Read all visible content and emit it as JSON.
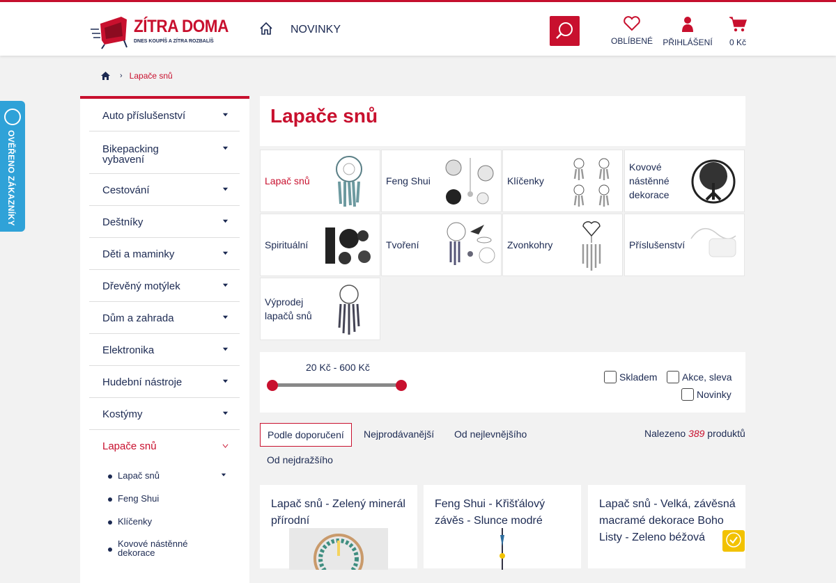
{
  "header": {
    "logo_title": "ZÍTRA DOMA",
    "logo_subtitle": "DNES KOUPÍŠ A ZÍTRA ROZBALÍŠ",
    "nav_novinky": "NOVINKY",
    "favorites_label": "OBLÍBENÉ",
    "login_label": "PŘIHLÁŠENÍ",
    "cart_total": "0 Kč"
  },
  "badge": {
    "text": "OVĚŘENO ZÁKAZNÍKY"
  },
  "breadcrumb": {
    "current": "Lapače snů"
  },
  "sidebar": {
    "categories": [
      {
        "label": "Auto příslušenství"
      },
      {
        "label": "Bikepacking vybavení"
      },
      {
        "label": "Cestování"
      },
      {
        "label": "Deštníky"
      },
      {
        "label": "Děti a maminky"
      },
      {
        "label": "Dřevěný motýlek"
      },
      {
        "label": "Dům a zahrada"
      },
      {
        "label": "Elektronika"
      },
      {
        "label": "Hudební nástroje"
      },
      {
        "label": "Kostýmy"
      },
      {
        "label": "Lapače snů"
      }
    ],
    "subcategories": [
      {
        "label": "Lapač snů"
      },
      {
        "label": "Feng Shui"
      },
      {
        "label": "Klíčenky"
      },
      {
        "label": "Kovové nástěnné dekorace"
      }
    ]
  },
  "main": {
    "title": "Lapače snů",
    "tiles": [
      {
        "label": "Lapač snů"
      },
      {
        "label": "Feng Shui"
      },
      {
        "label": "Klíčenky"
      },
      {
        "label": "Kovové nástěnné dekorace"
      },
      {
        "label": "Spirituální"
      },
      {
        "label": "Tvoření"
      },
      {
        "label": "Zvonkohry"
      },
      {
        "label": "Příslušenství"
      },
      {
        "label": "Výprodej lapačů snů"
      }
    ]
  },
  "filter": {
    "price_range": "20 Kč - 600 Kč",
    "price_min": 20,
    "price_max": 600,
    "skladem": "Skladem",
    "akce": "Akce, sleva",
    "novinky": "Novinky"
  },
  "sort": {
    "options": [
      "Podle doporučení",
      "Nejprodávanější",
      "Od nejlevnějšího",
      "Od nejdražšího"
    ],
    "found_prefix": "Nalezeno",
    "found_count": "389",
    "found_suffix": "produktů"
  },
  "products": [
    {
      "name": "Lapač snů - Zelený minerál přírodní"
    },
    {
      "name": "Feng Shui - Křišťálový závěs - Slunce modré"
    },
    {
      "name": "Lapač snů - Velká, závěsná macramé dekorace Boho Listy - Zeleno béžová"
    }
  ],
  "colors": {
    "accent": "#c8102e",
    "navy": "#1c2a52",
    "badge": "#2fa2d8"
  }
}
